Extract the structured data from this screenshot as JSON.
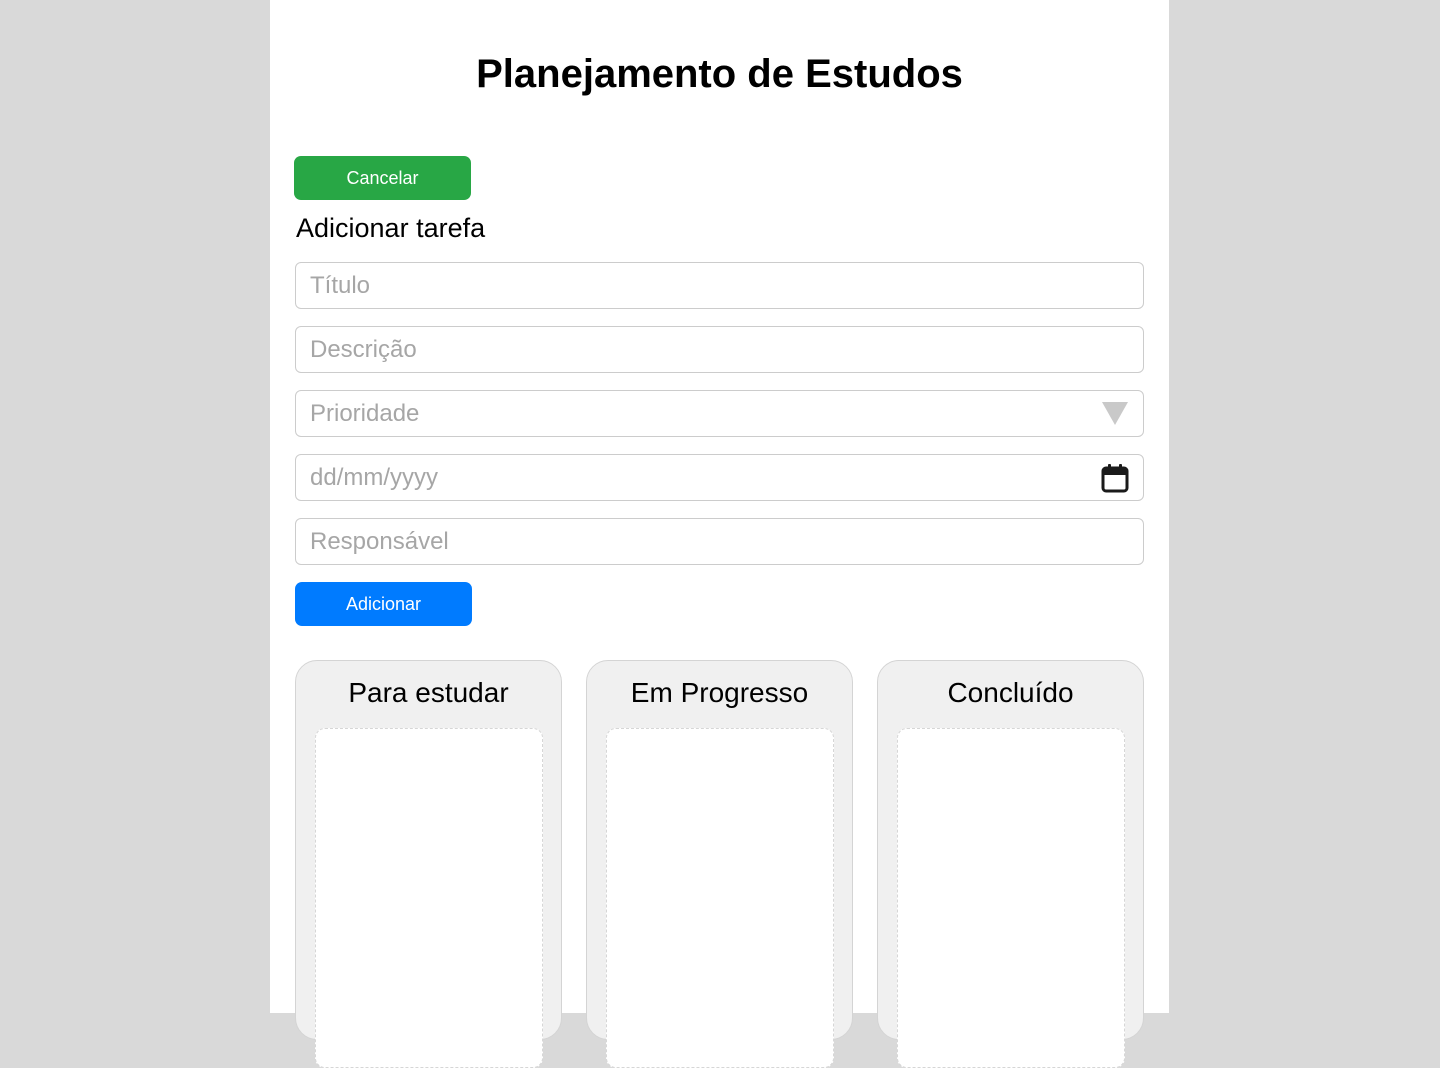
{
  "header": {
    "title": "Planejamento de Estudos"
  },
  "buttons": {
    "cancel_label": "Cancelar",
    "add_label": "Adicionar"
  },
  "form": {
    "section_label": "Adicionar tarefa",
    "title_placeholder": "Título",
    "description_placeholder": "Descrição",
    "priority_placeholder": "Prioridade",
    "date_placeholder": "dd/mm/yyyy",
    "responsible_placeholder": "Responsável"
  },
  "board": {
    "columns": [
      {
        "title": "Para estudar"
      },
      {
        "title": "Em Progresso"
      },
      {
        "title": "Concluído"
      }
    ]
  },
  "colors": {
    "cancel_button": "#28a745",
    "add_button": "#007bff",
    "background": "#d9d9d9"
  }
}
